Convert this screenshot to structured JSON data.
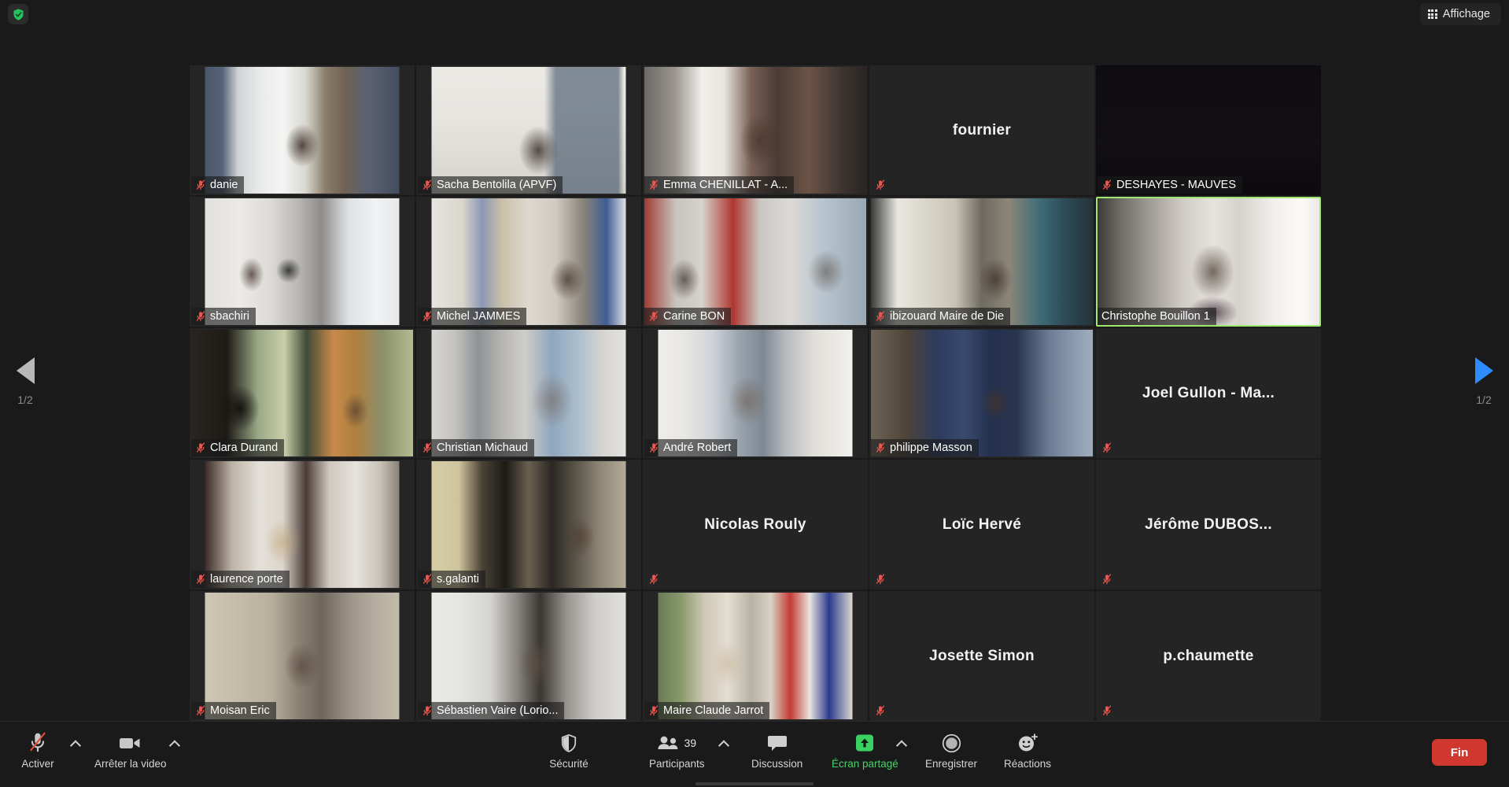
{
  "window": {
    "title": "Zoom Meeting",
    "background_color": "#1a1a1a"
  },
  "top_bar": {
    "security_badge_icon": "shield-check-icon",
    "security_badge_color": "#21c45d",
    "view_button": {
      "label": "Affichage",
      "icon": "grid-view-icon"
    }
  },
  "gallery": {
    "active_speaker_border_color": "#9fe870",
    "columns": 5,
    "rows": 5,
    "pager_left": {
      "arrow": "chevron-left-icon",
      "label": "1/2"
    },
    "pager_right": {
      "arrow": "chevron-right-icon",
      "label": "1/2",
      "color": "#2d8cff"
    },
    "participants": [
      {
        "name": "danie",
        "muted": true,
        "video": true,
        "active": false,
        "label_position": "plate"
      },
      {
        "name": "Sacha Bentolila (APVF)",
        "muted": true,
        "video": true,
        "active": false,
        "label_position": "plate"
      },
      {
        "name": "Emma CHENILLAT - A...",
        "muted": true,
        "video": true,
        "active": false,
        "label_position": "plate"
      },
      {
        "name": "fournier",
        "muted": true,
        "video": false,
        "active": false,
        "label_position": "center"
      },
      {
        "name": "DESHAYES - MAUVES",
        "muted": true,
        "video": true,
        "active": false,
        "label_position": "plate"
      },
      {
        "name": "sbachiri",
        "muted": true,
        "video": true,
        "active": false,
        "label_position": "plate"
      },
      {
        "name": "Michel JAMMES",
        "muted": true,
        "video": true,
        "active": false,
        "label_position": "plate"
      },
      {
        "name": "Carine BON",
        "muted": true,
        "video": true,
        "active": false,
        "label_position": "plate"
      },
      {
        "name": "ibizouard Maire de Die",
        "muted": true,
        "video": true,
        "active": false,
        "label_position": "plate"
      },
      {
        "name": "Christophe Bouillon 1",
        "muted": false,
        "video": true,
        "active": true,
        "label_position": "plate"
      },
      {
        "name": "Clara Durand",
        "muted": true,
        "video": true,
        "active": false,
        "label_position": "plate"
      },
      {
        "name": "Christian Michaud",
        "muted": true,
        "video": true,
        "active": false,
        "label_position": "plate"
      },
      {
        "name": "André Robert",
        "muted": true,
        "video": true,
        "active": false,
        "label_position": "plate"
      },
      {
        "name": "philippe Masson",
        "muted": true,
        "video": true,
        "active": false,
        "label_position": "plate"
      },
      {
        "name": "Joel Gullon  -  Ma...",
        "muted": true,
        "video": false,
        "active": false,
        "label_position": "center"
      },
      {
        "name": "laurence porte",
        "muted": true,
        "video": true,
        "active": false,
        "label_position": "plate"
      },
      {
        "name": "s.galanti",
        "muted": true,
        "video": true,
        "active": false,
        "label_position": "plate"
      },
      {
        "name": "Nicolas Rouly",
        "muted": true,
        "video": false,
        "active": false,
        "label_position": "center"
      },
      {
        "name": "Loïc Hervé",
        "muted": true,
        "video": false,
        "active": false,
        "label_position": "center"
      },
      {
        "name": "Jérôme  DUBOS...",
        "muted": true,
        "video": false,
        "active": false,
        "label_position": "center"
      },
      {
        "name": "Moisan Eric",
        "muted": true,
        "video": true,
        "active": false,
        "label_position": "plate"
      },
      {
        "name": "Sébastien Vaire (Lorio...",
        "muted": true,
        "video": true,
        "active": false,
        "label_position": "plate"
      },
      {
        "name": "Maire Claude Jarrot",
        "muted": true,
        "video": true,
        "active": false,
        "label_position": "plate"
      },
      {
        "name": "Josette Simon",
        "muted": true,
        "video": false,
        "active": false,
        "label_position": "center"
      },
      {
        "name": "p.chaumette",
        "muted": true,
        "video": false,
        "active": false,
        "label_position": "center"
      }
    ]
  },
  "toolbar": {
    "mute": {
      "label": "Activer",
      "icon": "microphone-muted-icon",
      "has_caret": true
    },
    "video": {
      "label": "Arrêter la video",
      "icon": "video-camera-icon",
      "has_caret": true
    },
    "security": {
      "label": "Sécurité",
      "icon": "shield-icon"
    },
    "participants": {
      "label": "Participants",
      "icon": "participants-icon",
      "count": "39",
      "has_caret": true
    },
    "chat": {
      "label": "Discussion",
      "icon": "chat-bubble-icon"
    },
    "share": {
      "label": "Écran partagé",
      "icon": "share-screen-icon",
      "accent": "#3ad162",
      "has_caret": true
    },
    "record": {
      "label": "Enregistrer",
      "icon": "record-circle-icon"
    },
    "reactions": {
      "label": "Réactions",
      "icon": "smiley-plus-icon"
    },
    "end": {
      "label": "Fin",
      "color": "#d0372f"
    }
  }
}
